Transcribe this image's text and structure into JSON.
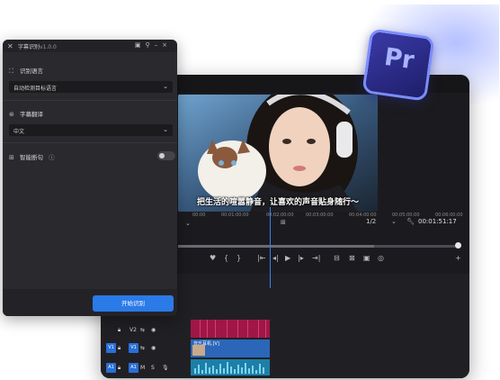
{
  "panel": {
    "title": "字幕识别",
    "version": "v1.0.0",
    "controls": [
      "▣",
      "⚲",
      "–",
      "×"
    ],
    "recog_lang_label": "识别语言",
    "recog_lang_value": "自动检测目标语言",
    "translate_label": "字幕翻译",
    "translate_value": "中文",
    "smart_line_label": "智能断句",
    "smart_line_on": false,
    "start_button": "开始识别"
  },
  "premiere": {
    "subtitle": "把生活的喧嚣静音，让喜欢的声音贴身随行～",
    "zoom_select": "1/2",
    "timecode": "00:01:51:17",
    "ruler_ticks": [
      "00:00",
      "00:01:00:00",
      "00:02:00:00",
      "00:03:00:00",
      "00:04:00:00",
      "00:05:00:00",
      "00:06:00:00"
    ],
    "tracks": {
      "v2": "V2",
      "v1_src": "V1",
      "v1": "V1",
      "a1_src": "A1",
      "a1": "A1"
    },
    "clip_label": "音乐耳机.[V]",
    "logo_text": "Pr"
  }
}
